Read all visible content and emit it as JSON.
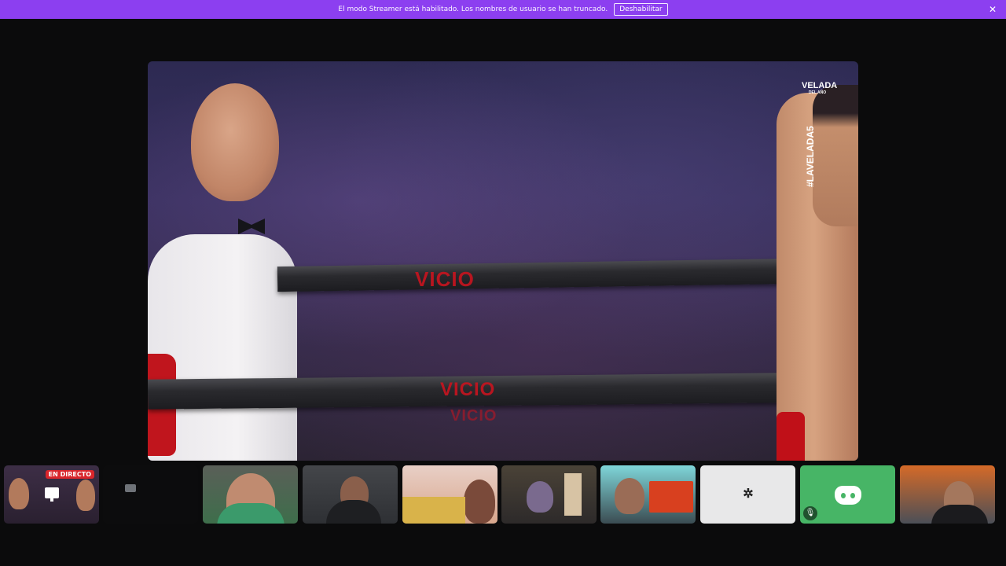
{
  "notice_bar": {
    "message": "El modo Streamer está habilitado. Los nombres de usuario se han truncado.",
    "disable_label": "Deshabilitar",
    "close_icon": "close-icon",
    "color": "#8c3ff0"
  },
  "stage": {
    "event_logo_top": "VELADA",
    "event_logo_bottom": "DEL AÑO",
    "hashtag": "#LAVELADA5",
    "rope_text": "VICIO"
  },
  "participants": [
    {
      "id": "stream",
      "live_label": "EN DIRECTO",
      "icon": "screen-share-icon"
    },
    {
      "id": "dark-tile"
    },
    {
      "id": "user-1"
    },
    {
      "id": "user-2"
    },
    {
      "id": "user-3"
    },
    {
      "id": "user-4"
    },
    {
      "id": "user-5"
    },
    {
      "id": "avatar-tile",
      "icon": "server-avatar"
    },
    {
      "id": "discord-tile",
      "icon": "discord-icon",
      "muted_icon": "mic-muted-icon",
      "color": "#47b566"
    },
    {
      "id": "user-6"
    }
  ]
}
